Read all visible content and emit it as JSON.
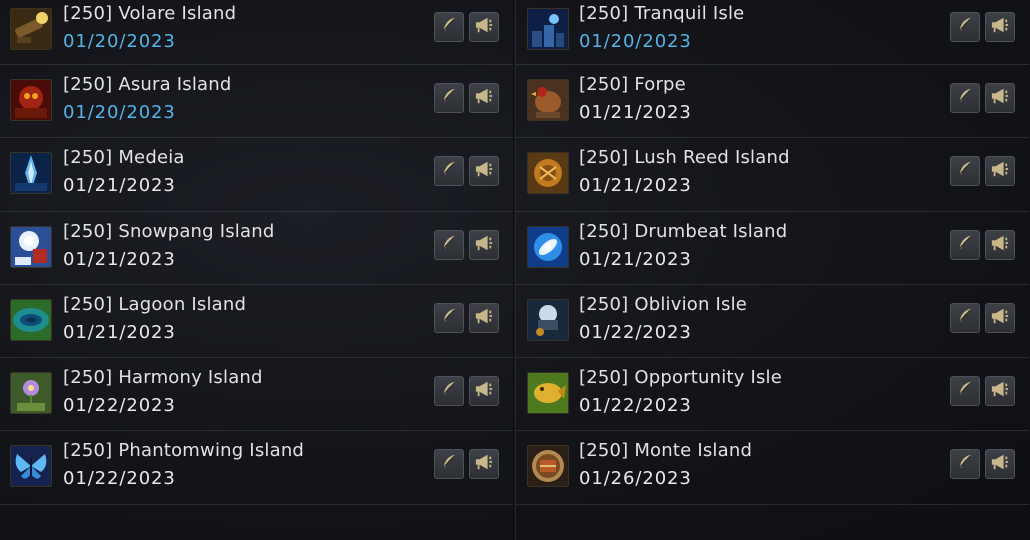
{
  "accent": "#55b3e6",
  "columns": [
    {
      "rows": [
        {
          "name": "[250] Volare Island",
          "date": "01/20/2023",
          "active": true,
          "icon": "volare-island-icon"
        },
        {
          "name": "[250] Asura Island",
          "date": "01/20/2023",
          "active": true,
          "icon": "asura-island-icon"
        },
        {
          "name": "[250] Medeia",
          "date": "01/21/2023",
          "active": false,
          "icon": "medeia-icon"
        },
        {
          "name": "[250] Snowpang Island",
          "date": "01/21/2023",
          "active": false,
          "icon": "snowpang-island-icon"
        },
        {
          "name": "[250] Lagoon Island",
          "date": "01/21/2023",
          "active": false,
          "icon": "lagoon-island-icon"
        },
        {
          "name": "[250] Harmony Island",
          "date": "01/22/2023",
          "active": false,
          "icon": "harmony-island-icon"
        },
        {
          "name": "[250] Phantomwing Island",
          "date": "01/22/2023",
          "active": false,
          "icon": "phantomwing-island-icon"
        }
      ]
    },
    {
      "rows": [
        {
          "name": "[250] Tranquil Isle",
          "date": "01/20/2023",
          "active": true,
          "icon": "tranquil-isle-icon"
        },
        {
          "name": "[250] Forpe",
          "date": "01/21/2023",
          "active": false,
          "icon": "forpe-icon"
        },
        {
          "name": "[250] Lush Reed Island",
          "date": "01/21/2023",
          "active": false,
          "icon": "lush-reed-island-icon"
        },
        {
          "name": "[250] Drumbeat Island",
          "date": "01/21/2023",
          "active": false,
          "icon": "drumbeat-island-icon"
        },
        {
          "name": "[250] Oblivion Isle",
          "date": "01/22/2023",
          "active": false,
          "icon": "oblivion-isle-icon"
        },
        {
          "name": "[250] Opportunity Isle",
          "date": "01/22/2023",
          "active": false,
          "icon": "opportunity-isle-icon"
        },
        {
          "name": "[250] Monte Island",
          "date": "01/26/2023",
          "active": false,
          "icon": "monte-island-icon"
        }
      ]
    }
  ]
}
